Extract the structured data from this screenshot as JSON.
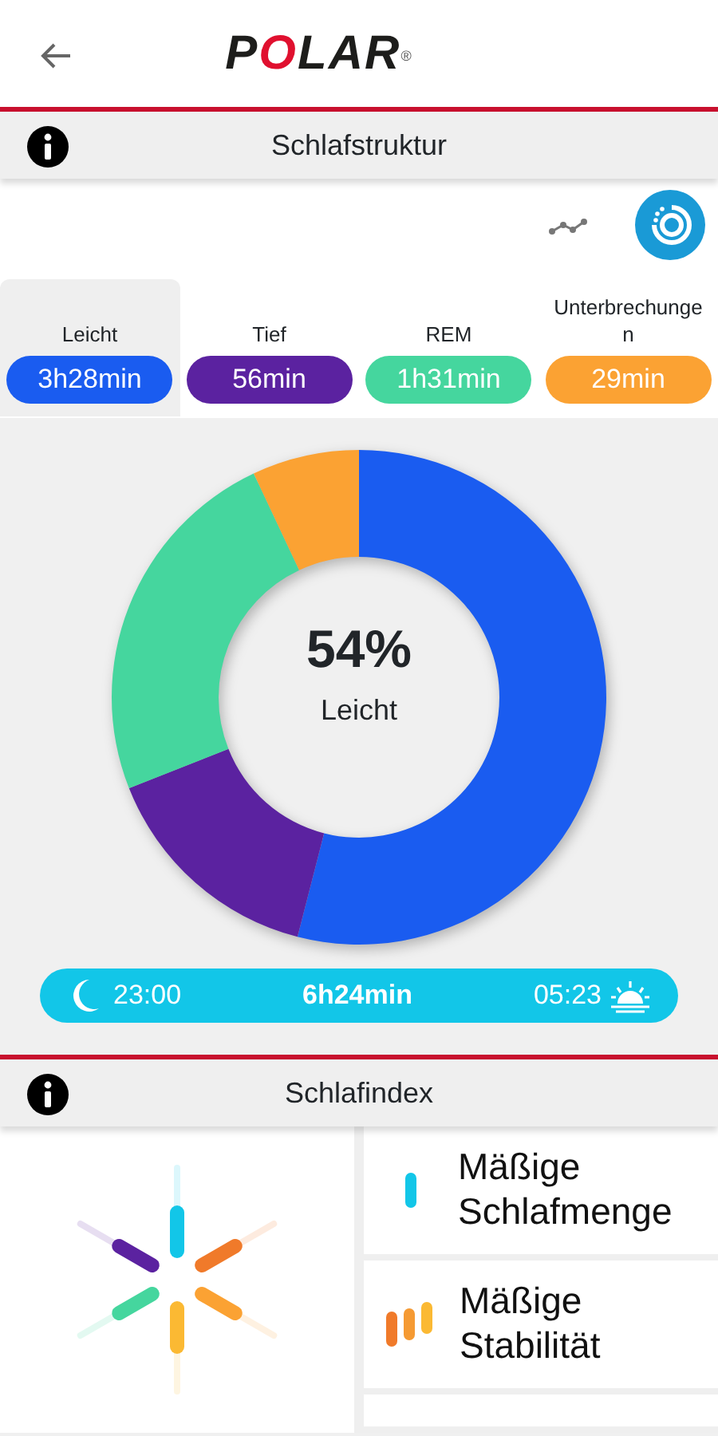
{
  "header": {
    "logo": "POLAR",
    "logo_mark": "®"
  },
  "structure": {
    "title": "Schlafstruktur",
    "views": [
      {
        "kind": "line",
        "selected": false
      },
      {
        "kind": "donut",
        "selected": true
      }
    ],
    "stages": [
      {
        "label": "Leicht",
        "duration": "3h28min",
        "color": "#1a5cf0",
        "selected": true
      },
      {
        "label": "Tief",
        "duration": "56min",
        "color": "#5b22a0",
        "selected": false
      },
      {
        "label": "REM",
        "duration": "1h31min",
        "color": "#45d69e",
        "selected": false
      },
      {
        "label": "Unterbrechunge n",
        "duration": "29min",
        "color": "#fba233",
        "selected": false
      }
    ],
    "center_value": "54%",
    "center_label": "Leicht",
    "chart_data": {
      "type": "donut",
      "values": [
        54,
        15,
        24,
        7
      ]
    },
    "sleep_start": "23:00",
    "sleep_total": "6h24min",
    "sleep_end": "05:23"
  },
  "index": {
    "title": "Schlafindex",
    "items": [
      {
        "kind": "amount",
        "text": "Mäßige Schlafmenge"
      },
      {
        "kind": "stability",
        "text": "Mäßige Stabilität"
      }
    ]
  }
}
